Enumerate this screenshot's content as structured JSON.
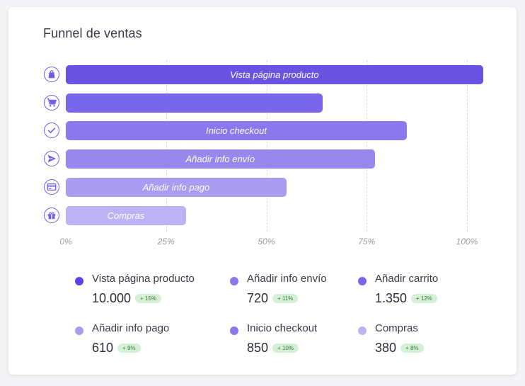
{
  "title": "Funnel de ventas",
  "colors": {
    "bars": [
      "#6a52e3",
      "#7a66ea",
      "#8a78ec",
      "#9888ee",
      "#aa9cf1",
      "#bdb2f4"
    ],
    "badge_text": "#2e7d32",
    "badge_bg": "#d6f0d8"
  },
  "chart_data": {
    "type": "bar",
    "orientation": "horizontal",
    "title": "Funnel de ventas",
    "xlim": [
      0,
      100
    ],
    "x_ticks": [
      "0%",
      "25%",
      "50%",
      "75%",
      "100%"
    ],
    "grid": "vertical-dashed",
    "bars": [
      {
        "label": "Vista página producto",
        "value": 104,
        "icon": "shopping-bag-icon"
      },
      {
        "label": "",
        "value": 64,
        "icon": "cart-icon"
      },
      {
        "label": "Inicio checkout",
        "value": 85,
        "icon": "check-icon"
      },
      {
        "label": "Añadir info envío",
        "value": 77,
        "icon": "send-icon"
      },
      {
        "label": "Añadir info pago",
        "value": 55,
        "icon": "credit-card-icon"
      },
      {
        "label": "Compras",
        "value": 30,
        "icon": "gift-icon"
      }
    ]
  },
  "legend": [
    {
      "name": "Vista página producto",
      "value": "10.000",
      "badge": "+ 15%",
      "color": "#5b45e0"
    },
    {
      "name": "Añadir info envío",
      "value": "720",
      "badge": "+ 11%",
      "color": "#8a78ec"
    },
    {
      "name": "Añadir carrito",
      "value": "1.350",
      "badge": "+ 12%",
      "color": "#7a66ea"
    },
    {
      "name": "Añadir info pago",
      "value": "610",
      "badge": "+ 9%",
      "color": "#aa9cf1"
    },
    {
      "name": "Inicio checkout",
      "value": "850",
      "badge": "+ 10%",
      "color": "#8a78ec"
    },
    {
      "name": "Compras",
      "value": "380",
      "badge": "+ 8%",
      "color": "#bdb2f4"
    }
  ]
}
